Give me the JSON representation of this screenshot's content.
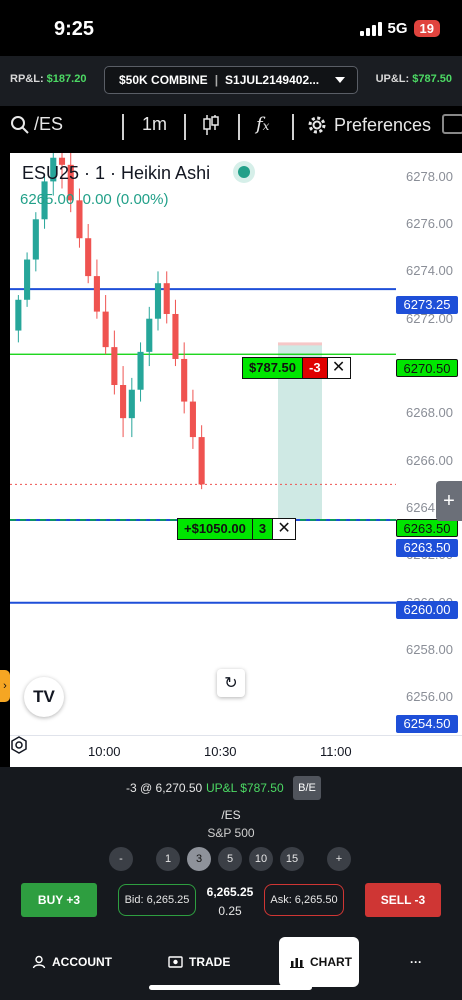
{
  "status_bar": {
    "time": "9:25",
    "network": "5G",
    "battery": "19"
  },
  "account_bar": {
    "rpl_label": "RP&L:",
    "rpl_value": "$187.20",
    "account_name": "$50K COMBINE",
    "account_id": "S1JUL2149402...",
    "upl_label": "UP&L:",
    "upl_value": "$787.50"
  },
  "toolbar": {
    "symbol": "/ES",
    "interval": "1m",
    "preferences_label": "Preferences"
  },
  "chart": {
    "title": "ESU25 · 1 · Heikin Ashi",
    "last": "6265.00",
    "change": "0.00 (0.00%)",
    "price_ticks": [
      "6278.00",
      "6276.00",
      "6274.00",
      "6272.00",
      "6270.00",
      "6268.00",
      "6266.00",
      "6264.00",
      "6262.00",
      "6260.00",
      "6258.00",
      "6256.00"
    ],
    "line_tags": {
      "blue_upper": "6273.25",
      "green_entry": "6270.50",
      "green_tp": "6263.50",
      "blue_tp": "6263.50",
      "blue_lower": "6260.00",
      "bottom": "6254.50"
    },
    "time_labels": [
      "10:00",
      "10:30",
      "11:00"
    ],
    "position_tag": {
      "amount": "$787.50",
      "qty": "-3",
      "close": "✕"
    },
    "target_tag": {
      "amount": "+$1050.00",
      "qty": "3",
      "close": "✕"
    },
    "logo_text": "TV",
    "colors": {
      "up": "#26a69a",
      "down": "#ef5350",
      "blue_line": "#1e4fd8",
      "green_line": "#00d000"
    }
  },
  "chart_data": {
    "type": "candlestick",
    "ylim": [
      6254.5,
      6279.0
    ],
    "x_ticks": [
      "10:00",
      "10:30",
      "11:00"
    ],
    "price_lines": [
      6273.25,
      6270.5,
      6263.5,
      6260.0
    ],
    "last_price": 6265.0,
    "candles": [
      [
        6271.5,
        6273.0,
        6271.0,
        6272.8
      ],
      [
        6272.8,
        6274.8,
        6272.5,
        6274.5
      ],
      [
        6274.5,
        6276.5,
        6274.0,
        6276.2
      ],
      [
        6276.2,
        6278.0,
        6275.8,
        6277.8
      ],
      [
        6277.8,
        6279.0,
        6277.2,
        6278.8
      ],
      [
        6278.8,
        6279.0,
        6277.5,
        6278.5
      ],
      [
        6278.5,
        6279.0,
        6276.5,
        6277.0
      ],
      [
        6277.0,
        6277.5,
        6275.0,
        6275.4
      ],
      [
        6275.4,
        6276.0,
        6273.5,
        6273.8
      ],
      [
        6273.8,
        6274.5,
        6272.0,
        6272.3
      ],
      [
        6272.3,
        6273.0,
        6270.5,
        6270.8
      ],
      [
        6270.8,
        6271.5,
        6268.8,
        6269.2
      ],
      [
        6269.2,
        6270.0,
        6267.0,
        6267.8
      ],
      [
        6267.8,
        6269.5,
        6267.0,
        6269.0
      ],
      [
        6269.0,
        6271.0,
        6268.5,
        6270.6
      ],
      [
        6270.6,
        6272.5,
        6270.0,
        6272.0
      ],
      [
        6272.0,
        6274.0,
        6271.5,
        6273.5
      ],
      [
        6273.5,
        6274.0,
        6271.8,
        6272.2
      ],
      [
        6272.2,
        6272.8,
        6270.0,
        6270.3
      ],
      [
        6270.3,
        6271.0,
        6268.0,
        6268.5
      ],
      [
        6268.5,
        6269.0,
        6266.5,
        6267.0
      ],
      [
        6267.0,
        6267.5,
        6264.8,
        6265.0
      ]
    ]
  },
  "panel": {
    "position_text": "-3 @ 6,270.50",
    "upl_text": "UP&L $787.50",
    "be_label": "B/E",
    "symbol": "/ES",
    "description": "S&P 500",
    "qty_buttons": [
      "-",
      "1",
      "3",
      "5",
      "10",
      "15",
      "+"
    ],
    "selected_qty": "3",
    "buy_label": "BUY +3",
    "bid": "Bid: 6,265.25",
    "last": "6,265.25",
    "chg": "0.25",
    "ask": "Ask: 6,265.50",
    "sell_label": "SELL -3"
  },
  "nav": {
    "account": "ACCOUNT",
    "trade": "TRADE",
    "chart": "CHART",
    "more": "···"
  }
}
